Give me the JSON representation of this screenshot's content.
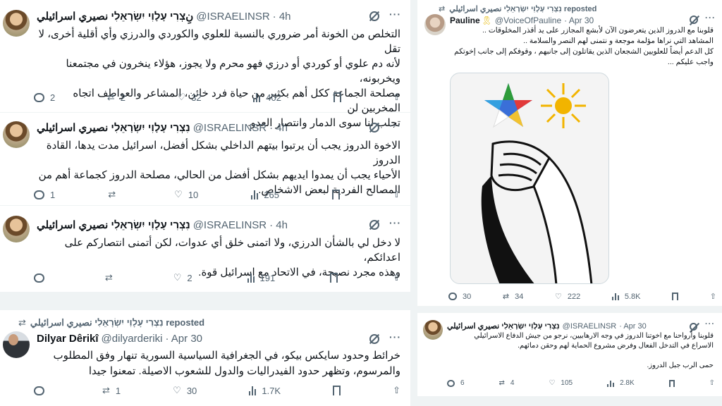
{
  "left_panel": {
    "tweets": [
      {
        "author_name": "نِצְרִי עָלָוִי יִשְׂרָאֵלִי نصيري اسرائيلي",
        "handle": "@ISRAELINSR",
        "time": "· 4h",
        "body": [
          "التخلص من الخونة أمر ضروري بالنسبة للعلوي والكوردي والدرزي وأي أقلية أخرى، لا تقل",
          "لأنه دم علوي أو كوردي أو درزي فهو محرم ولا يجوز، هؤلاء ينخرون في مجتمعنا ويخربونه،",
          "مصلحة الجماعة ككل أهم بكثير من حياة فرد خائن، المشاعر والعواطف اتجاه المخربين لن",
          "تجلب لنا سوى الدمار وانتصار العدو."
        ],
        "replies": "2",
        "reposts": "2",
        "likes": "32",
        "views": "402"
      },
      {
        "author_name": "נִצְרִי עָלָוִי יִשְׂרָאֵלִי نصيري اسرائيلي",
        "handle": "@ISRAELINSR",
        "time": "· 4h",
        "body": [
          "الاخوة الدروز يجب أن يرتبوا بيتهم الداخلي بشكل أفضل، اسرائيل مدت يدها، القادة الدروز",
          "الأحياء يجب أن يمدوا ايديهم بشكل أفضل من الحالي، مصلحة الدروز كجماعة أهم من",
          "المصالح الفردية لبعض الاشخاص."
        ],
        "replies": "1",
        "reposts": "",
        "likes": "10",
        "views": "265"
      },
      {
        "author_name": "נִצְרִי עָלָוִי יִשְׂרָאֵלִי نصيري اسرائيلي",
        "handle": "@ISRAELINSR",
        "time": "· 4h",
        "body": [
          "لا دخل لي بالشأن الدرزي، ولا اتمنى خلق أي عدوات، لكن أتمنى انتصاركم على اعدائكم،",
          "وهذه مجرد نصيحة، في الاتحاد مع اسرائيل قوة."
        ],
        "replies": "",
        "reposts": "",
        "likes": "2",
        "views": "191"
      }
    ]
  },
  "bottom_left": {
    "repost_label": "נִצְרִי עָלָוִי יִשְׂרָאֵלִי نصيري اسرائيلي reposted",
    "author_name": "Dilyar Dêrikî",
    "handle": "@dilyarderiki",
    "time": "· Apr 30",
    "body": [
      "خرائط وحدود سايكس بيكو، في الجغرافية السياسية السورية تنهار وفق المطلوب",
      "والمرسوم، وتظهر حدود الفيدراليات والدول للشعوب الاصيلة. تمعنوا جيدا"
    ],
    "replies": "",
    "reposts": "1",
    "likes": "30",
    "views": "1.7K"
  },
  "right_top": {
    "repost_label": "נִצְרִי עָלָוִי יִשְׂרָאֵלִי نصيري اسرائيلي reposted",
    "author_name": "Pauline",
    "ribbon": "🎗",
    "handle": "@VoiceOfPauline",
    "time": "· Apr 30",
    "body": [
      "قلوبنا مع الدروز الذين يتعرضون الآن لأبشع المجازر على يد أقذر المخلوقات ..",
      "المشاهد التي نراها مؤلمة موجعة و نتمنى لهم النصر والسلامة ..",
      "كل الدعم أيضاً للعلويين الشجعان الذين يقاتلون إلى جانبهم ، وقوفكم إلى جانب إخوتكم",
      "واجب عليكم ..."
    ],
    "replies": "30",
    "reposts": "34",
    "likes": "222",
    "views": "5.8K"
  },
  "right_bottom": {
    "author_name": "נִצְרִי עָלָוִי יִשְׂרָאֵלִי نصيري اسرائيلي",
    "handle": "@ISRAELINSR",
    "time": "· Apr 30",
    "body": [
      "قلوبنا وأرواحنا مع اخوتنا الدروز في وجه الارهابيين، نرجو من جيش الدفاع الاسرائيلي",
      "الاسراع في التدخل الفعال وفرض مشروع الحماية لهم وحقن دمائهم."
    ],
    "body2": "حمى الرب جبل الدروز.",
    "replies": "6",
    "reposts": "4",
    "likes": "105",
    "views": "2.8K"
  },
  "colors": {
    "text": "#0f1419",
    "muted": "#536471",
    "border": "#cfd9de",
    "background": "#eff3f4"
  }
}
